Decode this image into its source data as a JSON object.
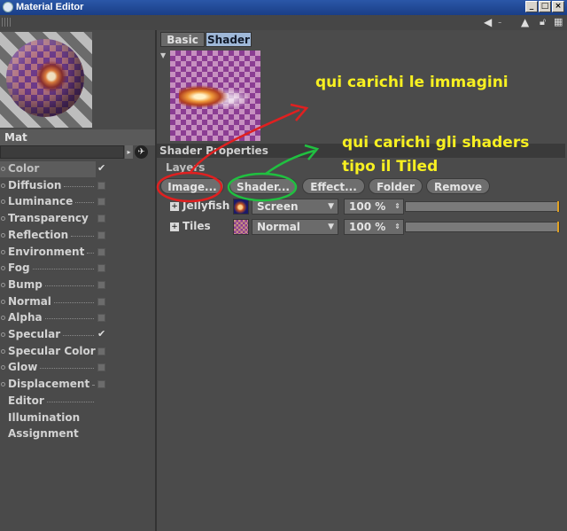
{
  "window": {
    "title": "Material Editor",
    "buttons": [
      "_",
      "□",
      "×"
    ]
  },
  "toolbar": {
    "icons": [
      "arrow-left-icon",
      "arrow-up-icon",
      "lock-icon",
      "config-icon"
    ]
  },
  "material": {
    "name": "Mat"
  },
  "channels": [
    {
      "label": "Color",
      "dots": false,
      "state": "checked",
      "selected": true
    },
    {
      "label": "Diffusion",
      "dots": true,
      "state": "box"
    },
    {
      "label": "Luminance",
      "dots": true,
      "state": "box"
    },
    {
      "label": "Transparency",
      "dots": false,
      "state": "box"
    },
    {
      "label": "Reflection",
      "dots": true,
      "state": "box"
    },
    {
      "label": "Environment",
      "dots": true,
      "state": "box"
    },
    {
      "label": "Fog",
      "dots": true,
      "state": "box"
    },
    {
      "label": "Bump",
      "dots": true,
      "state": "box"
    },
    {
      "label": "Normal",
      "dots": true,
      "state": "box"
    },
    {
      "label": "Alpha",
      "dots": true,
      "state": "box"
    },
    {
      "label": "Specular",
      "dots": true,
      "state": "checked"
    },
    {
      "label": "Specular Color",
      "dots": false,
      "state": "box"
    },
    {
      "label": "Glow",
      "dots": true,
      "state": "box"
    },
    {
      "label": "Displacement",
      "dots": true,
      "state": "box"
    },
    {
      "label": "Editor",
      "dots": true,
      "state": "none"
    },
    {
      "label": "Illumination",
      "dots": false,
      "state": "none"
    },
    {
      "label": "Assignment",
      "dots": false,
      "state": "none"
    }
  ],
  "tabs": {
    "basic": "Basic",
    "shader": "Shader",
    "active": "shader"
  },
  "shader": {
    "section_title": "Shader Properties",
    "layers_label": "Layers",
    "buttons": {
      "image": "Image...",
      "shader": "Shader...",
      "effect": "Effect...",
      "folder": "Folder",
      "remove": "Remove"
    },
    "layers": [
      {
        "name": "Jellyfish",
        "mode": "Screen",
        "opacity": "100 %",
        "opacity_value": 1.0
      },
      {
        "name": "Tiles",
        "mode": "Normal",
        "opacity": "100 %",
        "opacity_value": 1.0
      }
    ]
  },
  "annotations": {
    "image_note": "qui carichi le immagini",
    "shader_note_line1": "qui carichi gli shaders",
    "shader_note_line2": "tipo il Tiled",
    "image_color": "#e02020",
    "shader_color": "#20c040",
    "text_color": "#f7f021"
  }
}
